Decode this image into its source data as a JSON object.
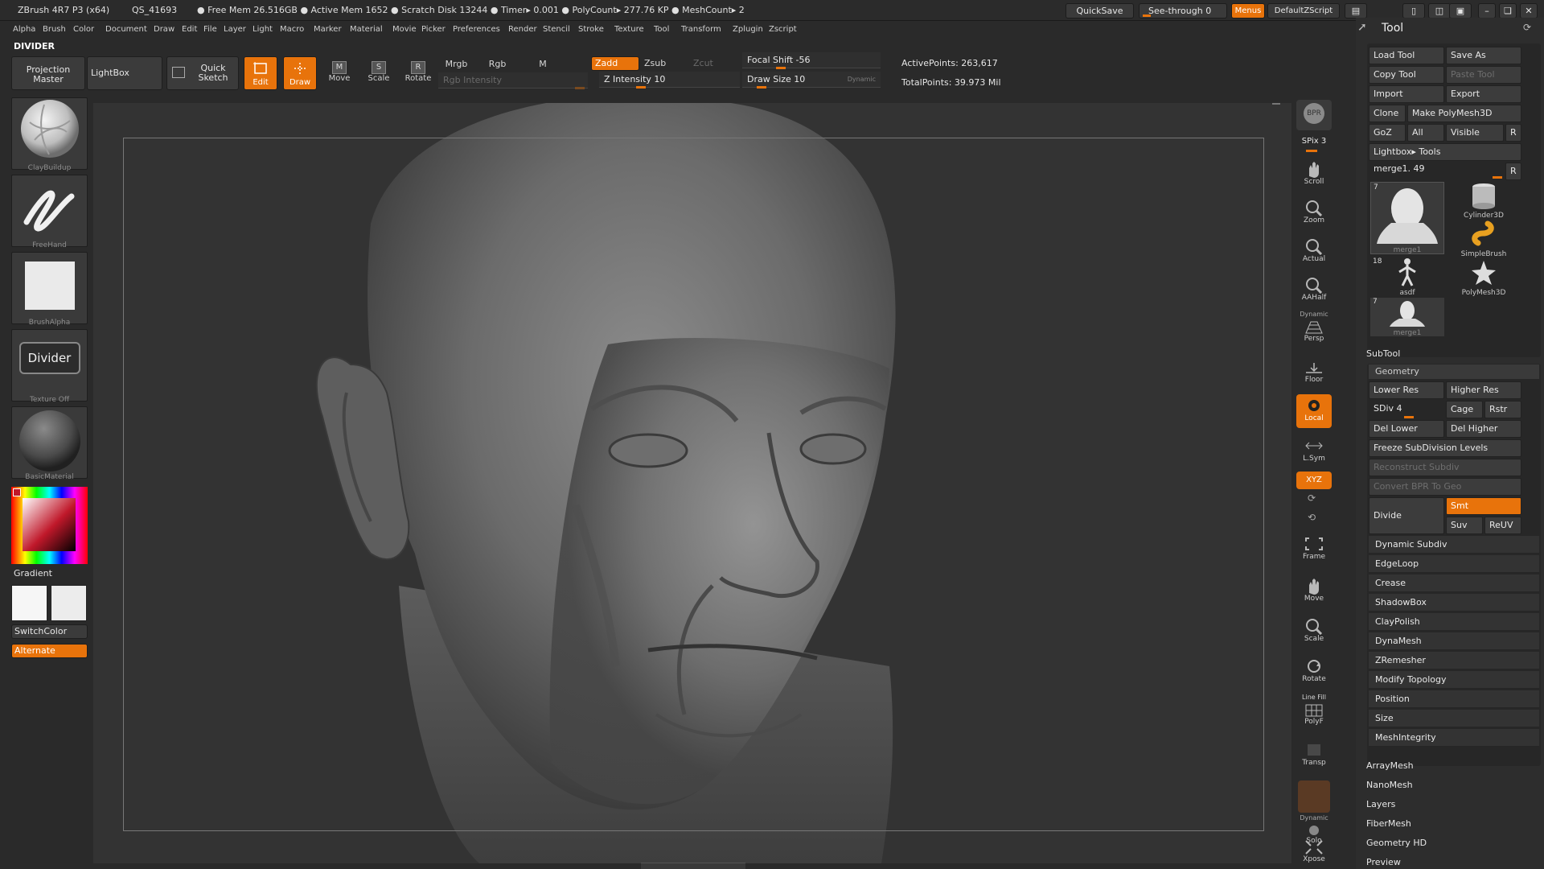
{
  "titlebar": {
    "app": "ZBrush 4R7 P3 (x64)",
    "session": "QS_41693",
    "stats": "● Free Mem 26.516GB ● Active Mem 1652 ● Scratch Disk 13244 ●  Timer▸ 0.001  ● PolyCount▸ 277.76 KP  ● MeshCount▸ 2",
    "quicksave": "QuickSave",
    "seethrough": "See-through  0",
    "menus": "Menus",
    "defaultzscript": "DefaultZScript"
  },
  "menubar": [
    "Alpha",
    "Brush",
    "Color",
    "Document",
    "Draw",
    "Edit",
    "File",
    "Layer",
    "Light",
    "Macro",
    "Marker",
    "Material",
    "Movie",
    "Picker",
    "Preferences",
    "Render",
    "Stencil",
    "Stroke",
    "Texture",
    "Tool",
    "Transform",
    "Zplugin",
    "Zscript"
  ],
  "divider_title": "DIVIDER",
  "toolbar": {
    "projection_master": "Projection Master",
    "lightbox": "LightBox",
    "quick_sketch": "Quick Sketch",
    "edit": "Edit",
    "draw": "Draw",
    "move": "Move",
    "scale": "Scale",
    "rotate": "Rotate",
    "mrgb": "Mrgb",
    "rgb": "Rgb",
    "m": "M",
    "rgb_intensity": "Rgb Intensity",
    "zadd": "Zadd",
    "zsub": "Zsub",
    "zcut": "Zcut",
    "z_intensity": "Z Intensity 10",
    "focal_shift": "Focal Shift -56",
    "draw_size": "Draw Size 10",
    "dynamic": "Dynamic",
    "active_points": "ActivePoints: 263,617",
    "total_points": "TotalPoints: 39.973 Mil"
  },
  "leftpanel": {
    "brush1": "ClayBuildup",
    "brush2": "FreeHand",
    "alpha": "BrushAlpha",
    "texture_btn": "Divider",
    "texture": "Texture Off",
    "material": "BasicMaterial",
    "gradient": "Gradient",
    "switchcolor": "SwitchColor",
    "alternate": "Alternate"
  },
  "shelf": {
    "bpr": "BPR",
    "spix": "SPix 3",
    "scroll": "Scroll",
    "zoom": "Zoom",
    "actual": "Actual",
    "aahalf": "AAHalf",
    "dynamic": "Dynamic",
    "persp": "Persp",
    "floor": "Floor",
    "local": "Local",
    "lsym": "L.Sym",
    "xyz": "XYZ",
    "frame": "Frame",
    "move": "Move",
    "scale": "Scale",
    "rotate": "Rotate",
    "linefill": "Line Fill",
    "polyf": "PolyF",
    "transp": "Transp",
    "dynamic2": "Dynamic",
    "solo": "Solo",
    "xpose": "Xpose"
  },
  "tool": {
    "title": "Tool",
    "load_tool": "Load Tool",
    "save_as": "Save As",
    "copy_tool": "Copy Tool",
    "paste_tool": "Paste Tool",
    "import": "Import",
    "export": "Export",
    "clone": "Clone",
    "make_polymesh": "Make PolyMesh3D",
    "goz": "GoZ",
    "all": "All",
    "visible": "Visible",
    "r": "R",
    "lightbox_tools": "Lightbox▸ Tools",
    "merge_slider": "merge1. 49",
    "thumbs": [
      {
        "name": "merge1",
        "count": "7"
      },
      {
        "name": "Cylinder3D",
        "count": ""
      },
      {
        "name": "SimpleBrush",
        "count": ""
      },
      {
        "name": "asdf",
        "count": "18"
      },
      {
        "name": "PolyMesh3D",
        "count": ""
      },
      {
        "name": "merge1",
        "count": "7"
      }
    ],
    "subtool": "SubTool",
    "geometry": "Geometry",
    "lower_res": "Lower Res",
    "higher_res": "Higher Res",
    "sdiv": "SDiv 4",
    "cage": "Cage",
    "rstr": "Rstr",
    "del_lower": "Del Lower",
    "del_higher": "Del Higher",
    "freeze": "Freeze SubDivision Levels",
    "reconstruct": "Reconstruct Subdiv",
    "convert_bpr": "Convert BPR To Geo",
    "divide": "Divide",
    "smt": "Smt",
    "suv": "Suv",
    "reuv": "ReUV",
    "geo_items": [
      "Dynamic Subdiv",
      "EdgeLoop",
      "Crease",
      "ShadowBox",
      "ClayPolish",
      "DynaMesh",
      "ZRemesher",
      "Modify Topology",
      "Position",
      "Size",
      "MeshIntegrity"
    ],
    "sub_items": [
      "ArrayMesh",
      "NanoMesh",
      "Layers",
      "FiberMesh",
      "Geometry HD",
      "Preview"
    ]
  }
}
